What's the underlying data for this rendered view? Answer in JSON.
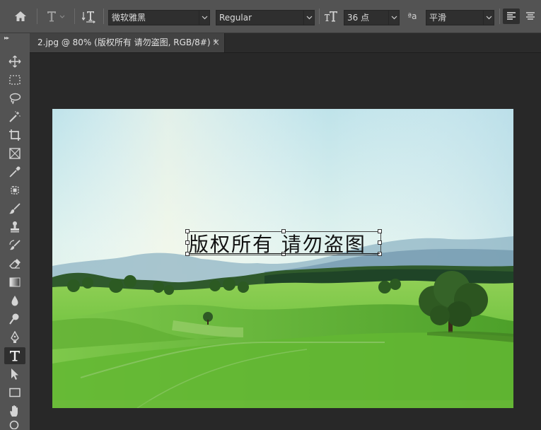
{
  "options_bar": {
    "font_family": "微软雅黑",
    "font_style": "Regular",
    "font_size": "36 点",
    "antialias_symbol": "ªa",
    "antialias": "平滑"
  },
  "document_tab": {
    "title": "2.jpg @ 80% (版权所有 请勿盗图, RGB/8#) *",
    "close": "×"
  },
  "canvas": {
    "text_layer": "版权所有 请勿盗图"
  },
  "toolbar": {
    "grip": "▸▸",
    "active_tool": "type-tool"
  },
  "colors": {
    "panel": "#535353",
    "canvas_bg": "#282828",
    "field": "#2f2f2f"
  }
}
